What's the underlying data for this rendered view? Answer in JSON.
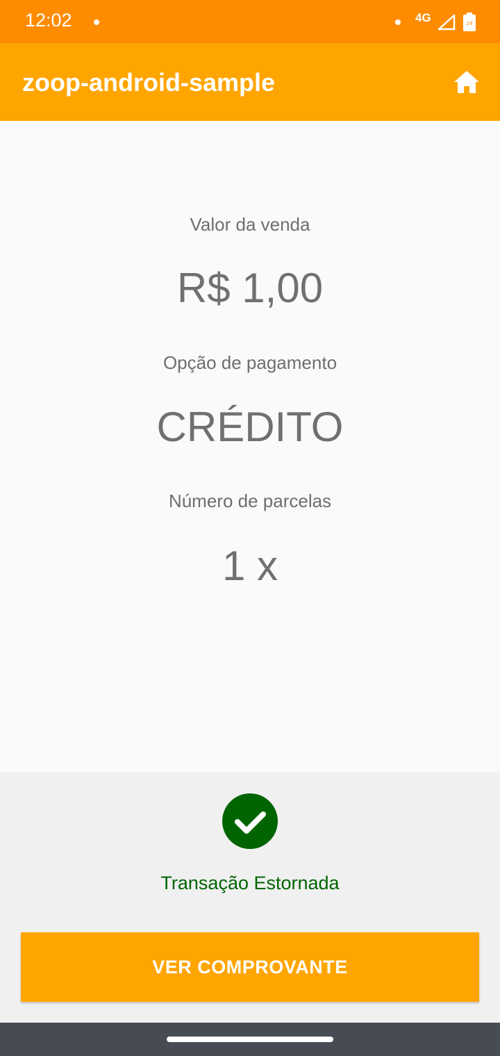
{
  "status_bar": {
    "time": "12:02",
    "network": "4G",
    "battery_level": "29"
  },
  "app_bar": {
    "title": "zoop-android-sample"
  },
  "sale": {
    "amount_label": "Valor da venda",
    "amount_value": "R$ 1,00",
    "payment_label": "Opção de pagamento",
    "payment_value": "CRÉDITO",
    "installments_label": "Número de parcelas",
    "installments_value": "1 x"
  },
  "result": {
    "status_text": "Transação Estornada",
    "button_label": "VER COMPROVANTE"
  },
  "colors": {
    "status_bar": "#ff8c00",
    "app_bar": "#ffa500",
    "success_green": "#006400",
    "nav_bar": "#474b53"
  },
  "icons": {
    "home": "home-icon",
    "success": "check-circle-icon",
    "signal": "signal-icon",
    "battery": "battery-icon"
  }
}
